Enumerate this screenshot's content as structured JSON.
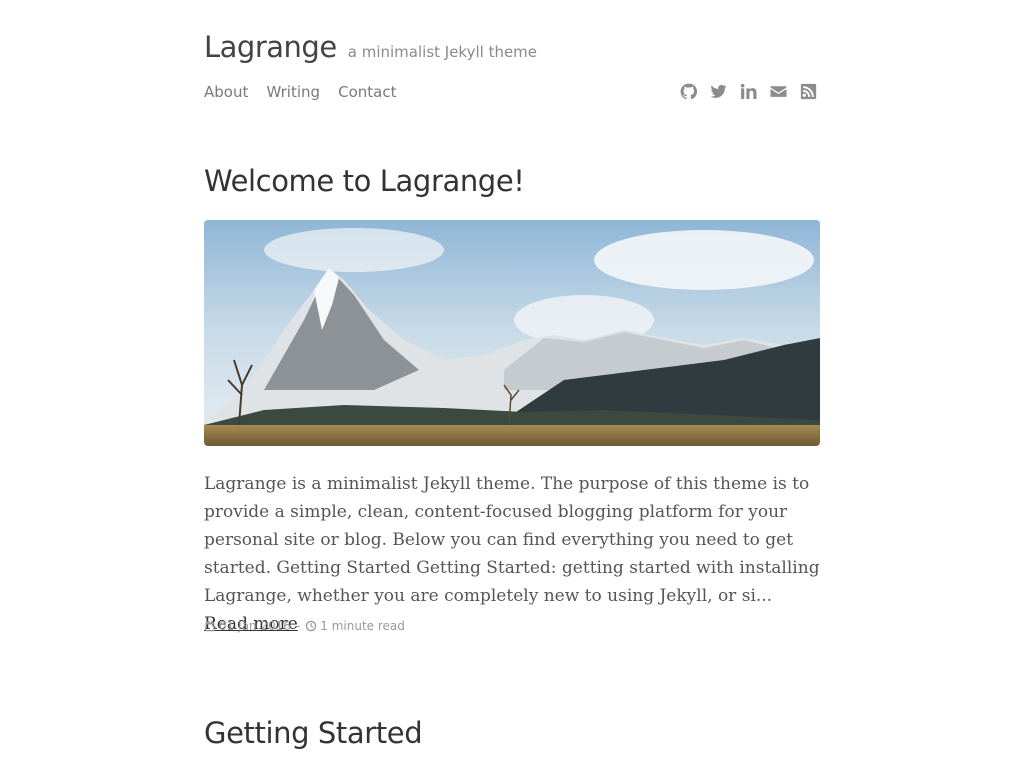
{
  "site": {
    "title": "Lagrange",
    "tagline": "a minimalist Jekyll theme"
  },
  "nav": {
    "items": [
      {
        "label": "About"
      },
      {
        "label": "Writing"
      },
      {
        "label": "Contact"
      }
    ]
  },
  "social": {
    "icons": [
      "github-icon",
      "twitter-icon",
      "linkedin-icon",
      "envelope-icon",
      "rss-icon"
    ]
  },
  "posts": [
    {
      "title": "Welcome to Lagrange!",
      "image": "mountain landscape",
      "excerpt": "Lagrange is a minimalist Jekyll theme. The purpose of this theme is to provide a simple, clean, content-focused blogging platform for your personal site or blog. Below you can find everything you need to get started. Getting Started Getting Started: getting started with installing Lagrange, whether you are completely new to using Jekyll, or si...",
      "read_more": "Read more",
      "date": "01 Jan 2016",
      "separator": "-",
      "read_time": "1 minute read"
    },
    {
      "title": "Getting Started"
    }
  ],
  "colors": {
    "text": "#333333",
    "muted": "#8a8a8a",
    "background": "#ffffff"
  }
}
